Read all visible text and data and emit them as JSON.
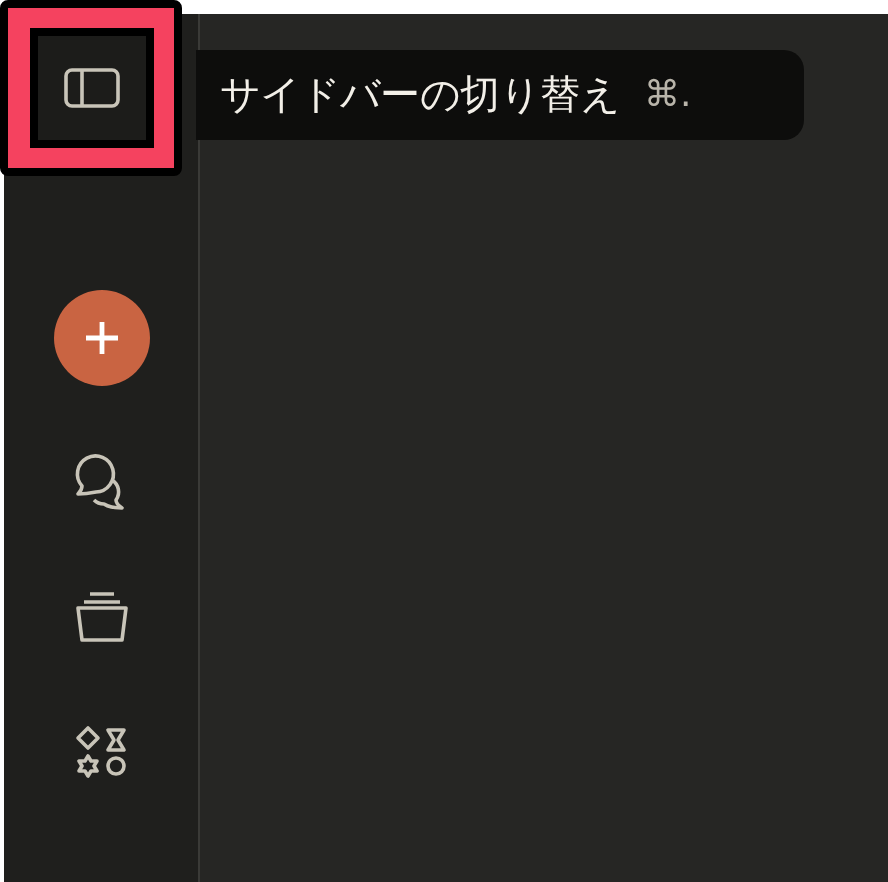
{
  "sidebar": {
    "toggle_button": {
      "highlighted": true
    },
    "tooltip": {
      "label": "サイドバーの切り替え",
      "shortcut": "⌘."
    },
    "items": [
      {
        "kind": "new"
      },
      {
        "kind": "chats"
      },
      {
        "kind": "projects"
      },
      {
        "kind": "artifacts"
      }
    ]
  }
}
